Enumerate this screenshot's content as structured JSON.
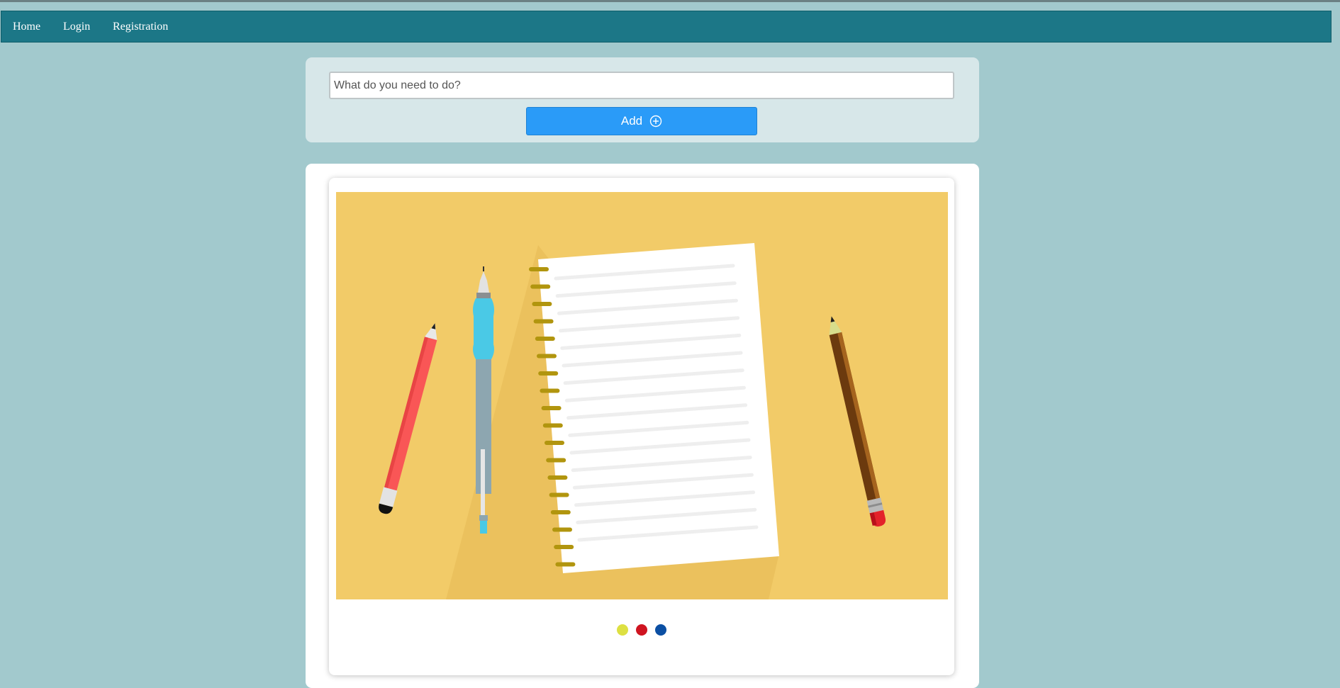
{
  "nav": {
    "items": [
      "Home",
      "Login",
      "Registration"
    ],
    "background": "#1c7787"
  },
  "todo": {
    "placeholder": "What do you need to do?",
    "value": "",
    "add_label": "Add",
    "add_icon": "plus-circle-icon",
    "button_color": "#2a9bf8"
  },
  "carousel": {
    "image": "notebook-pens-pencils-illustration",
    "slide_count": 3,
    "dot_colors": [
      "#dde042",
      "#cf1420",
      "#0b4fa3"
    ]
  },
  "colors": {
    "page_background": "#a2c9cd",
    "illustration_background": "#f2cb68"
  }
}
